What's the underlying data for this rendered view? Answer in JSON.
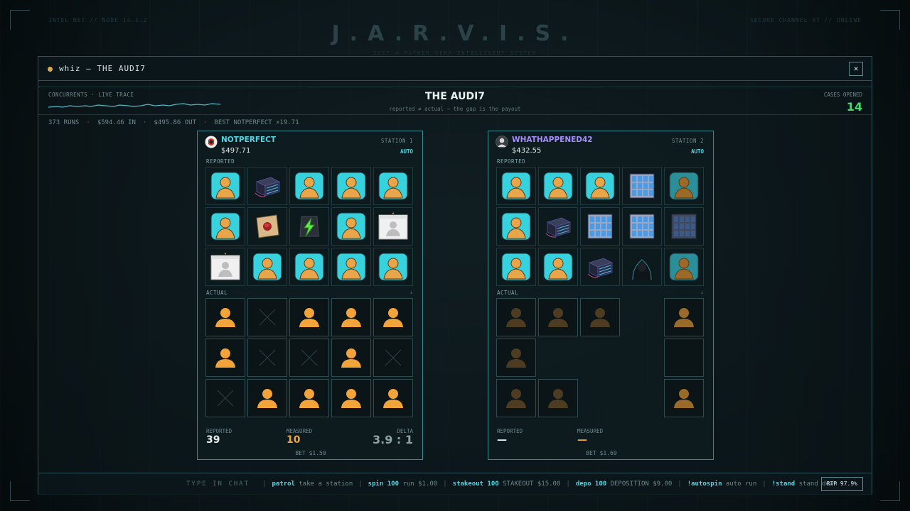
{
  "topbar": {
    "left_tiny": "INTEL NET // NODE 14.1.2",
    "right_tiny": "SECURE CHANNEL 07 // ONLINE",
    "title": "J.A.R.V.I.S.",
    "subtitle": "JUST A RATHER VERY INTELLIGENT SYSTEM"
  },
  "window": {
    "title": "whiz — THE AUDI7",
    "close_label": "✕"
  },
  "header": {
    "concurrents_label": "CONCURRENTS · LIVE TRACE",
    "title": "THE AUDI7",
    "subtitle": "reported ≠ actual — the gap is the payout",
    "cases_label": "CASES OPENED",
    "cases_value": "14"
  },
  "stats": {
    "runs": "373 RUNS",
    "in": "$594.46 IN",
    "out": "$495.86 OUT",
    "best": "BEST NOTPERFECT ×19.71"
  },
  "colors": {
    "accent": "#4fd6e4",
    "green": "#3de06a",
    "orange": "#f2a33a",
    "purple_name": "#a58cff"
  },
  "stations": [
    {
      "name": "NOTPERFECT",
      "balance": "$497.71",
      "label": "STATION 1",
      "mode": "AUTO",
      "reported_label": "REPORTED",
      "actual_label": "ACTUAL",
      "reported_grid": [
        [
          "bust",
          "server",
          "bust",
          "bust",
          "bust"
        ],
        [
          "bust",
          "deposition",
          "lightning",
          "bust",
          "photo"
        ],
        [
          "photo",
          "bust",
          "bust",
          "bust",
          "bust"
        ]
      ],
      "actual_grid": [
        [
          "person",
          "x",
          "person",
          "person",
          "person"
        ],
        [
          "person",
          "x",
          "x",
          "person",
          "x"
        ],
        [
          "x",
          "person",
          "person",
          "person",
          "person"
        ]
      ],
      "footer": {
        "reported_label": "REPORTED",
        "reported_value": "39",
        "measured_label": "MEASURED",
        "measured_value": "10",
        "delta_label": "DELTA",
        "delta_value": "3.9 : 1",
        "bet": "BET $1.50"
      }
    },
    {
      "name": "WHATHAPPENED42",
      "balance": "$432.55",
      "label": "STATION 2",
      "mode": "AUTO",
      "reported_label": "REPORTED",
      "actual_label": "ACTUAL",
      "reported_grid": [
        [
          "bust",
          "bust",
          "bust",
          "building",
          "bust-dim"
        ],
        [
          "bust",
          "server",
          "building",
          "building",
          "building-dim"
        ],
        [
          "bust",
          "bust",
          "server",
          "hacker",
          "bust-dim"
        ]
      ],
      "actual_grid": [
        [
          "person-dim",
          "person-dim",
          "person-dim",
          "empty",
          "person-half"
        ],
        [
          "person-dim",
          "empty",
          "empty",
          "empty",
          "blank"
        ],
        [
          "person-dim",
          "person-dim",
          "empty",
          "empty",
          "person-half"
        ]
      ],
      "footer": {
        "reported_label": "REPORTED",
        "reported_value": "—",
        "measured_label": "MEASURED",
        "measured_value": "—",
        "bet": "BET $1.69"
      }
    }
  ],
  "chat": {
    "prompt": "TYPE IN CHAT",
    "commands": [
      {
        "cmd": "patrol",
        "desc": "take a station"
      },
      {
        "cmd": "spin 100",
        "desc": "run $1.00"
      },
      {
        "cmd": "stakeout 100",
        "desc": "STAKEOUT $15.00"
      },
      {
        "cmd": "depo 100",
        "desc": "DEPOSITION $9.00"
      },
      {
        "cmd": "!autospin",
        "desc": "auto run"
      },
      {
        "cmd": "!stand",
        "desc": "stand down"
      }
    ],
    "rtp": "RTP 97.9%"
  }
}
